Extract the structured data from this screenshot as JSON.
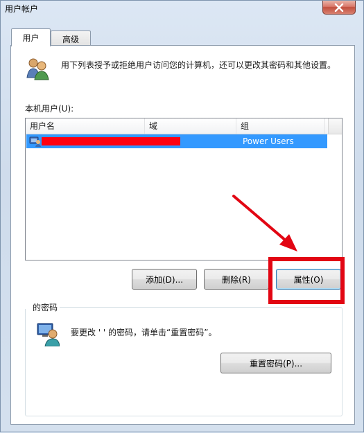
{
  "window": {
    "title": "用户帐户",
    "close_icon": "close-icon"
  },
  "tabs": [
    {
      "label": "用户",
      "selected": true
    },
    {
      "label": "高级",
      "selected": false
    }
  ],
  "intro": {
    "icon": "users-icon",
    "text": "用下列表授予或拒绝用户访问您的计算机，还可以更改其密码和其他设置。"
  },
  "users_list": {
    "label": "本机用户(U):",
    "columns": [
      "用户名",
      "域",
      "组"
    ],
    "rows": [
      {
        "username": "",
        "domain": "",
        "group": "Power Users",
        "selected": true
      }
    ]
  },
  "buttons": {
    "add": "添加(D)...",
    "remove": "删除(R)",
    "properties": "属性(O)"
  },
  "password_section": {
    "legend": "的密码",
    "text": "要更改 '  ' 的密码，请单击“重置密码”。",
    "reset_button": "重置密码(P)..."
  },
  "colors": {
    "selection": "#3399ff",
    "annotation_red": "#e20613"
  }
}
